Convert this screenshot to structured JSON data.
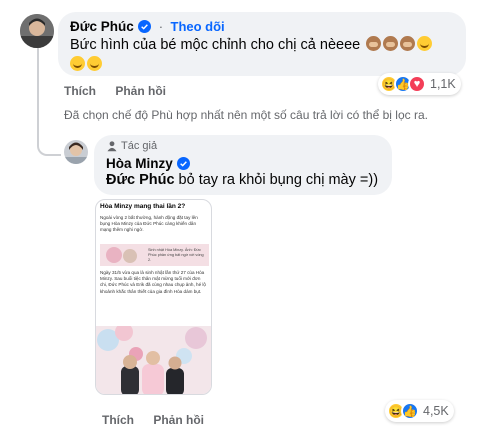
{
  "comment1": {
    "author": "Đức Phúc",
    "follow_label": "Theo dõi",
    "separator": "·",
    "text": "Bức hình của bé mộc chỉnh cho chị cả nèeee",
    "actions": {
      "like": "Thích",
      "reply": "Phản hồi"
    },
    "reaction_count": "1,1K"
  },
  "filter_note": "Đã chọn chế độ Phù hợp nhất nên một số câu trả lời có thể bị lọc ra.",
  "reply": {
    "badge": "Tác giả",
    "author": "Hòa Minzy",
    "mention": "Đức Phúc",
    "text": " bỏ tay ra khỏi bụng chị mày =))",
    "actions": {
      "like": "Thích",
      "reply": "Phản hồi"
    },
    "reaction_count": "4,5K"
  },
  "article": {
    "headline": "Hòa Minzy mang thai lần 2?",
    "lead": "Ngoài vòng 2 bất thường, hành động đặt tay lên bụng Hòa Minzy của Đức Phúc càng khiến dân mạng thêm nghi ngờ.",
    "caption": "Sinh nhật Hòa Minzy. Ảnh: Đức Phúc phản ứng bất ngờ với vòng 2.",
    "body": "Ngày 31/5 vừa qua là sinh nhật lần thứ 27 của Hòa Minzy. Sau buổi tiệc thân mật mừng tuổi mới đơn chi, Đức Phúc và Erik đã cùng nhau chụp ảnh, hé lộ khoảnh khắc thân thiết của gia đình Hòa dám bụt."
  },
  "colors": {
    "accent": "#0866ff",
    "bubble": "#f0f2f5",
    "muted": "#65676b"
  }
}
